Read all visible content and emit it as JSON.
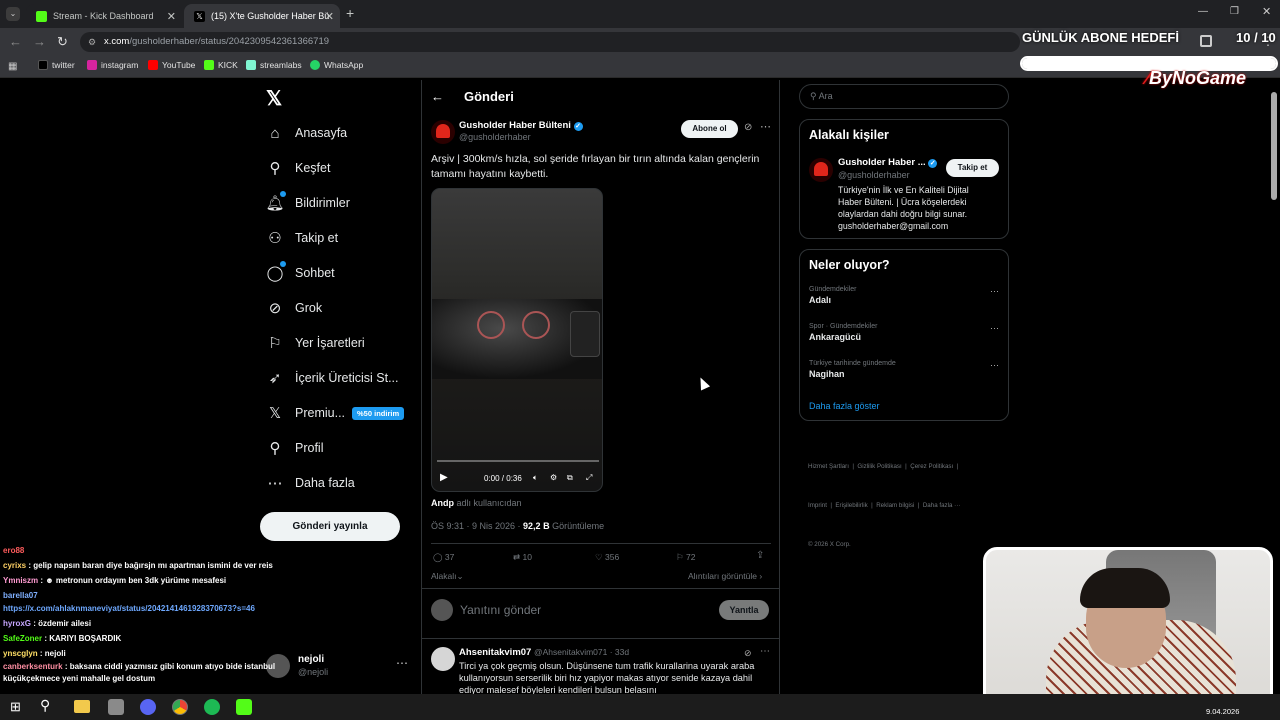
{
  "browser": {
    "tabs": [
      {
        "title": "Stream - Kick Dashboard"
      },
      {
        "title": "(15) X'te Gusholder Haber Bülte"
      }
    ],
    "url_host": "x.com",
    "url_path": "/gusholderhaber/status/2042309542361366719",
    "bookmarks": [
      "twitter",
      "instagram",
      "YouTube",
      "KICK",
      "streamlabs",
      "WhatsApp"
    ]
  },
  "overlay": {
    "goal_label": "GÜNLÜK ABONE HEDEFİ",
    "goal_count": "10 / 10",
    "goal_progress": 1.0,
    "brand": "ByNoGame"
  },
  "sidebar": {
    "items": [
      {
        "label": "Anasayfa",
        "icon": "home-icon"
      },
      {
        "label": "Keşfet",
        "icon": "search-icon"
      },
      {
        "label": "Bildirimler",
        "icon": "bell-icon"
      },
      {
        "label": "Takip et",
        "icon": "follow-icon"
      },
      {
        "label": "Sohbet",
        "icon": "chat-icon"
      },
      {
        "label": "Grok",
        "icon": "grok-icon"
      },
      {
        "label": "Yer İşaretleri",
        "icon": "bookmark-icon"
      },
      {
        "label": "İçerik Üreticisi St...",
        "icon": "rocket-icon"
      },
      {
        "label": "Premiu...",
        "icon": "x-logo-icon"
      },
      {
        "label": "Profil",
        "icon": "profile-icon"
      },
      {
        "label": "Daha fazla",
        "icon": "more-icon"
      }
    ],
    "premium_badge": "%50 indirim",
    "post_button": "Gönderi yayınla",
    "account_name": "nejoli",
    "account_handle": "@nejoli"
  },
  "post": {
    "header": "Gönderi",
    "author_name": "Gusholder Haber Bülteni",
    "author_handle": "@gusholderhaber",
    "subscribe_label": "Abone ol",
    "text": "Arşiv | 300km/s hızla, sol şeride fırlayan bir tırın altında kalan gençlerin tamamı hayatını kaybetti.",
    "video_time": "0:00 / 0:36",
    "video_progress": 0,
    "tag_user": "Andp",
    "tag_suffix": "adlı kullanıcıdan",
    "timestamp": "ÖS 9:31 · 9 Nis 2026 · ",
    "views": "92,2 B",
    "views_label": " Görüntüleme",
    "replies": "37",
    "reposts": "10",
    "likes": "356",
    "bookmarks": "72",
    "relevance": "Alakalı",
    "quotes_link": "Alıntıları görüntüle",
    "reply_placeholder": "Yanıtını gönder",
    "reply_button": "Yanıtla"
  },
  "reply": {
    "name": "Ahsenitakvim07",
    "handle_time": "@Ahsenitakvim071 · 33d",
    "text": "Tirci ya çok geçmiş olsun. Düşünsene tum trafik kurallarina uyarak araba kullanıyorsun serserilik biri hız yapiyor makas atıyor senide kazaya dahil ediyor malesef böyleleri kendileri bulsun belasını"
  },
  "right": {
    "search_placeholder": "Ara",
    "related_title": "Alakalı kişiler",
    "related_name": "Gusholder Haber ...",
    "related_handle": "@gusholderhaber",
    "follow_label": "Takip et",
    "related_bio": "Türkiye'nin İlk ve En Kaliteli Dijital Haber Bülteni. | Ücra köşelerdeki olaylardan dahi doğru bilgi sunar. gusholderhaber@gmail.com",
    "trending_title": "Neler oluyor?",
    "trends": [
      {
        "category": "Gündemdekiler",
        "title": "Adalı"
      },
      {
        "category": "Spor · Gündemdekiler",
        "title": "Ankaragücü"
      },
      {
        "category": "Türkiye tarihinde gündemde",
        "title": "Nagihan"
      }
    ],
    "show_more": "Daha fazla göster",
    "footer_line1": "Hizmet Şartları  |  Gizlilik Politikası  |  Çerez Politikası  |",
    "footer_line2": "Imprint  |  Erişilebilirlik  |  Reklam bilgisi  |  Daha fazla ···",
    "footer_line3": "© 2026 X Corp."
  },
  "chat": [
    {
      "user": "ero88",
      "msg": "",
      "color": "#ff5c5c"
    },
    {
      "user": "cyrixs",
      "msg": "gelip napsın baran diye bağırsjn mı apartman ismini de ver reis",
      "color": "#ffd166"
    },
    {
      "user": "Ymniszm",
      "msg": "☻ metronun ordayım ben 3dk yürüme mesafesi",
      "color": "#ff9bd2"
    },
    {
      "user": "barella07",
      "msg": "",
      "color": "#7fb0ff"
    },
    {
      "user": "https://x.com/ahlaknmaneviyat/status/2042141461928370673?s=46",
      "msg": "",
      "color": "#6ea8fe"
    },
    {
      "user": "hyroxG",
      "msg": "özdemir ailesi",
      "color": "#c7a6ff"
    },
    {
      "user": "SafeZoner",
      "msg": "KARIYI BOŞARDIK",
      "color": "#53fc18"
    },
    {
      "user": "ynscglyn",
      "msg": "nejoli",
      "color": "#ffe066"
    },
    {
      "user": "canberksenturk",
      "msg": "baksana ciddi yazmısız gibi konum atıyo bide istanbul küçükçekmece yeni mahalle gel dostum",
      "color": "#ff8fa3"
    }
  ],
  "taskbar": {
    "date": "9.04.2026"
  },
  "colors": {
    "accent": "#1d9bf0",
    "kick_green": "#53fc18",
    "bg": "#000000",
    "border": "#2f3336"
  }
}
